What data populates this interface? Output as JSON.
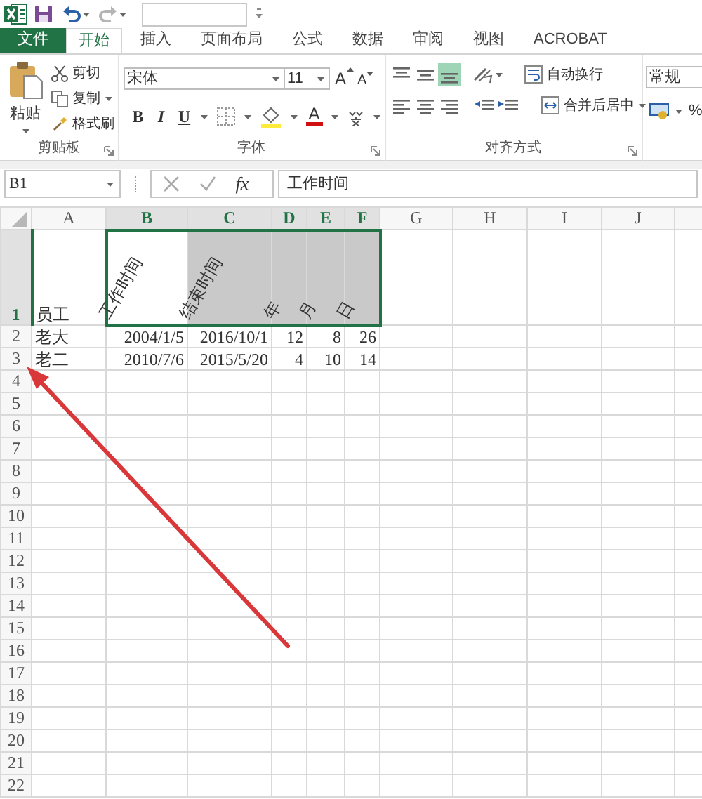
{
  "ribbon_tabs": [
    {
      "label": "文件",
      "kind": "file",
      "selected": false
    },
    {
      "label": "开始",
      "kind": "tab",
      "selected": true
    },
    {
      "label": "插入",
      "kind": "tab",
      "selected": false
    },
    {
      "label": "页面布局",
      "kind": "tab",
      "selected": false
    },
    {
      "label": "公式",
      "kind": "tab",
      "selected": false
    },
    {
      "label": "数据",
      "kind": "tab",
      "selected": false
    },
    {
      "label": "审阅",
      "kind": "tab",
      "selected": false
    },
    {
      "label": "视图",
      "kind": "tab",
      "selected": false
    },
    {
      "label": "ACROBAT",
      "kind": "tab",
      "selected": false
    }
  ],
  "clipboard": {
    "paste": "粘贴",
    "cut": "剪切",
    "copy": "复制",
    "format_painter": "格式刷",
    "title": "剪贴板"
  },
  "font": {
    "name": "宋体",
    "size": "11",
    "grow": "A",
    "shrink": "A",
    "bold": "B",
    "italic": "I",
    "underline": "U",
    "color_letter": "A",
    "title": "字体"
  },
  "alignment": {
    "vertical": [
      {
        "kind": "top",
        "selected": false
      },
      {
        "kind": "middle",
        "selected": false
      },
      {
        "kind": "bottom",
        "selected": true
      }
    ],
    "wrap_text": "自动换行",
    "merge_center": "合并后居中",
    "title": "对齐方式"
  },
  "number": {
    "format": "常规",
    "percent": "%"
  },
  "formula_bar": {
    "name_box": "B1",
    "function_label": "fx",
    "formula": "工作时间"
  },
  "sheet": {
    "columns": [
      {
        "label": "A",
        "selected": false
      },
      {
        "label": "B",
        "selected": true
      },
      {
        "label": "C",
        "selected": true
      },
      {
        "label": "D",
        "selected": true
      },
      {
        "label": "E",
        "selected": true
      },
      {
        "label": "F",
        "selected": true
      },
      {
        "label": "G",
        "selected": false
      },
      {
        "label": "H",
        "selected": false
      },
      {
        "label": "I",
        "selected": false
      },
      {
        "label": "J",
        "selected": false
      }
    ],
    "rows": [
      {
        "header": "1",
        "selected": true,
        "cells": [
          {
            "text": "员工",
            "rotated": false,
            "active": false,
            "shaded": false
          },
          {
            "text": "工作时间",
            "rotated": true,
            "active": true,
            "shaded": false
          },
          {
            "text": "结束时间",
            "rotated": true,
            "active": false,
            "shaded": true
          },
          {
            "text": "年",
            "rotated": true,
            "active": false,
            "shaded": true
          },
          {
            "text": "月",
            "rotated": true,
            "active": false,
            "shaded": true
          },
          {
            "text": "日",
            "rotated": true,
            "active": false,
            "shaded": true
          }
        ]
      },
      {
        "header": "2",
        "selected": false,
        "cells": [
          {
            "text": "老大",
            "kind": "text"
          },
          {
            "text": "2004/1/5",
            "kind": "number"
          },
          {
            "text": "2016/10/1",
            "kind": "number"
          },
          {
            "text": "12",
            "kind": "number"
          },
          {
            "text": "8",
            "kind": "number"
          },
          {
            "text": "26",
            "kind": "number"
          }
        ]
      },
      {
        "header": "3",
        "selected": false,
        "cells": [
          {
            "text": "老二",
            "kind": "text"
          },
          {
            "text": "2010/7/6",
            "kind": "number"
          },
          {
            "text": "2015/5/20",
            "kind": "number"
          },
          {
            "text": "4",
            "kind": "number"
          },
          {
            "text": "10",
            "kind": "number"
          },
          {
            "text": "14",
            "kind": "number"
          }
        ]
      },
      {
        "header": "4",
        "selected": false,
        "cells": []
      },
      {
        "header": "5",
        "selected": false,
        "cells": []
      },
      {
        "header": "6",
        "selected": false,
        "cells": []
      },
      {
        "header": "7",
        "selected": false,
        "cells": []
      },
      {
        "header": "8",
        "selected": false,
        "cells": []
      },
      {
        "header": "9",
        "selected": false,
        "cells": []
      },
      {
        "header": "10",
        "selected": false,
        "cells": []
      },
      {
        "header": "11",
        "selected": false,
        "cells": []
      },
      {
        "header": "12",
        "selected": false,
        "cells": []
      },
      {
        "header": "13",
        "selected": false,
        "cells": []
      },
      {
        "header": "14",
        "selected": false,
        "cells": []
      },
      {
        "header": "15",
        "selected": false,
        "cells": []
      },
      {
        "header": "16",
        "selected": false,
        "cells": []
      },
      {
        "header": "17",
        "selected": false,
        "cells": []
      },
      {
        "header": "18",
        "selected": false,
        "cells": []
      },
      {
        "header": "19",
        "selected": false,
        "cells": []
      },
      {
        "header": "20",
        "selected": false,
        "cells": []
      },
      {
        "header": "21",
        "selected": false,
        "cells": []
      },
      {
        "header": "22",
        "selected": false,
        "cells": []
      }
    ]
  }
}
